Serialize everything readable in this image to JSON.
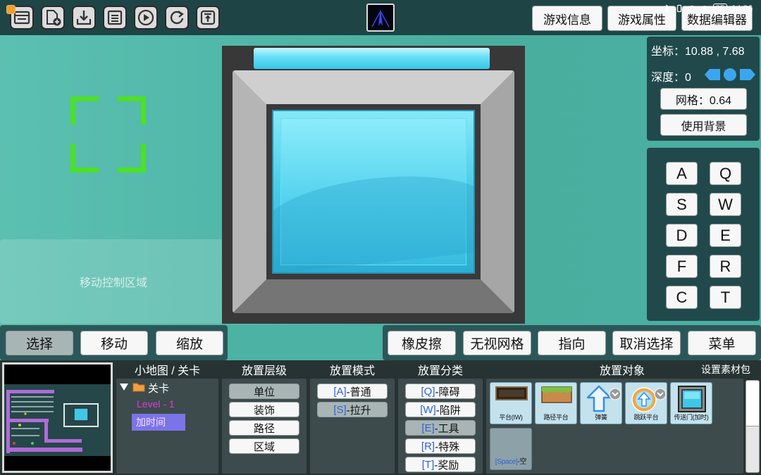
{
  "status_bar": {
    "battery": "25",
    "time": "14:06"
  },
  "toolbar": {
    "icons": [
      "open-icon",
      "new-file-icon",
      "import-icon",
      "save-icon",
      "play-icon",
      "refresh-icon",
      "export-icon"
    ]
  },
  "top_buttons": {
    "game_info": "游戏信息",
    "game_props": "游戏属性",
    "data_editor": "数据编辑器"
  },
  "canvas": {
    "move_area_label": "移动控制区域"
  },
  "info_panel": {
    "coord": "坐标：10.88 , 7.68",
    "depth": "深度：0",
    "grid_button": "网格：0.64",
    "background_button": "使用背景"
  },
  "hotkeys": [
    "A",
    "Q",
    "S",
    "W",
    "D",
    "E",
    "F",
    "R",
    "C",
    "T"
  ],
  "tool_buttons": {
    "items": [
      "选择",
      "移动",
      "缩放"
    ],
    "selected": 0
  },
  "edit_buttons": [
    "橡皮擦",
    "无视网格",
    "指向",
    "取消选择",
    "菜单"
  ],
  "headers": {
    "minimap_level": "小地图 / 关卡",
    "layer": "放置层级",
    "mode": "放置模式",
    "category": "放置分类",
    "object": "放置对象",
    "asset_pack": "设置素材包"
  },
  "level_tree": {
    "root": "关卡",
    "level": "Level - 1",
    "selected_item": "加时间"
  },
  "layers": {
    "items": [
      "单位",
      "装饰",
      "路径",
      "区域"
    ],
    "selected": 0
  },
  "modes": {
    "items": [
      {
        "key": "[A]",
        "label": "-普通"
      },
      {
        "key": "[S]",
        "label": "-拉升"
      }
    ],
    "selected": 1
  },
  "categories": {
    "items": [
      {
        "key": "[Q]",
        "label": "-障碍"
      },
      {
        "key": "[W]",
        "label": "-陷阱"
      },
      {
        "key": "[E]",
        "label": "-工具"
      },
      {
        "key": "[R]",
        "label": "-特殊"
      },
      {
        "key": "[T]",
        "label": "-奖励"
      }
    ],
    "selected": 2
  },
  "objects": {
    "items": [
      {
        "label": "平台(IW)",
        "icon": "platform-icon"
      },
      {
        "label": "路径平台",
        "icon": "path-platform-icon"
      },
      {
        "label": "弹簧",
        "icon": "spring-icon"
      },
      {
        "label": "跳跃平台",
        "icon": "jump-platform-icon"
      },
      {
        "label": "传送门(加时)",
        "icon": "portal-icon"
      }
    ],
    "empty": {
      "key": "[Space]",
      "label": "-空"
    }
  },
  "colors": {
    "selection_green": "#4de026",
    "hotkey_blue": "#2f62d6",
    "level_text": "#d63ed8",
    "depth_arrow_blue": "#3ba6ef",
    "tree_selected_bg": "#7b74e8"
  }
}
